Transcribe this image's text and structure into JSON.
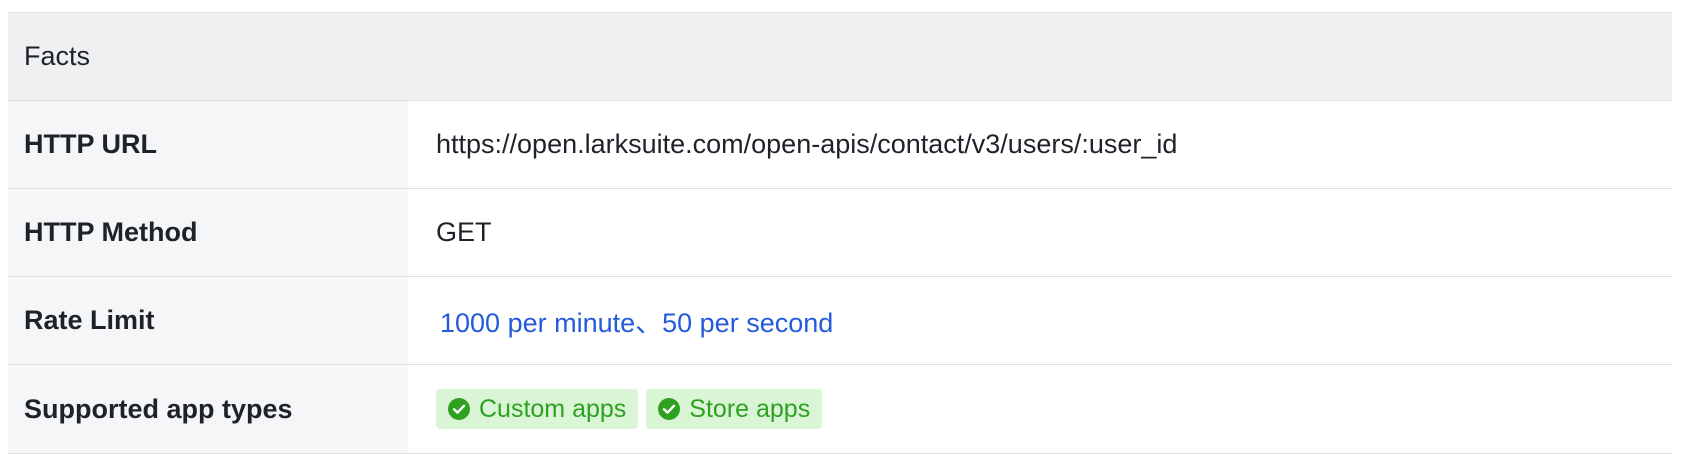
{
  "facts": {
    "title": "Facts",
    "rows": [
      {
        "key": "HTTP URL",
        "value": "https://open.larksuite.com/open-apis/contact/v3/users/:user_id"
      },
      {
        "key": "HTTP Method",
        "value": "GET"
      },
      {
        "key": "Rate Limit",
        "value": "1000 per minute、50 per second"
      },
      {
        "key": "Supported app types",
        "tags": [
          "Custom apps",
          "Store apps"
        ]
      }
    ]
  },
  "colors": {
    "header_bg": "#eff0f1",
    "key_bg": "#f5f6f7",
    "link": "#245bdb",
    "tag_bg": "#d9f5d6",
    "tag_text": "#2ea121"
  },
  "icons": {
    "tag_icon": "check-circle-icon"
  }
}
